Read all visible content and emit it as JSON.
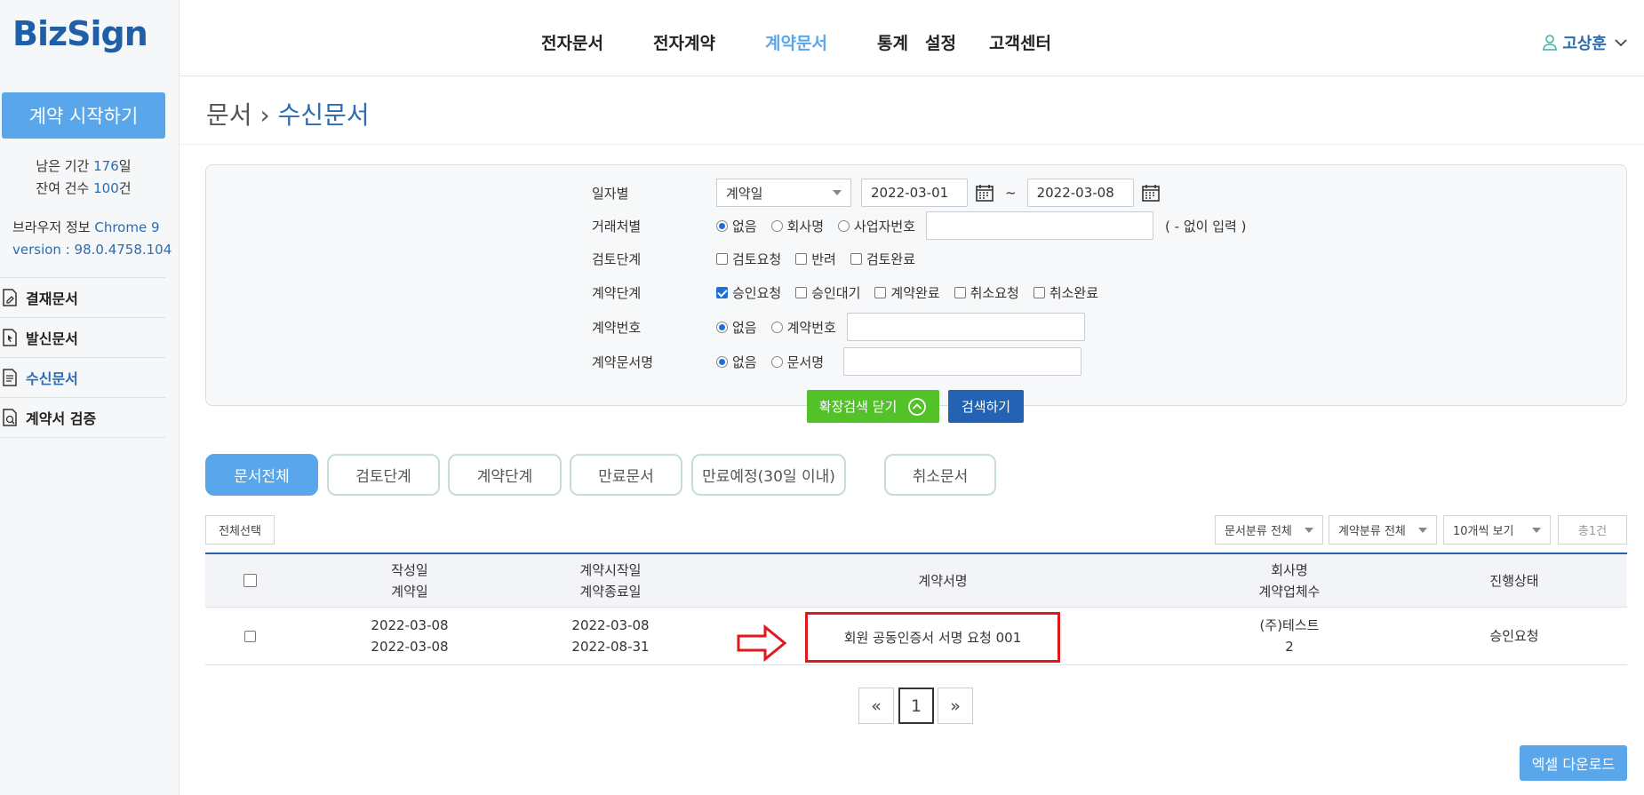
{
  "brand": {
    "logo": "BizSign"
  },
  "sidebar": {
    "start_button": "계약 시작하기",
    "remaining_period_label": "남은 기간",
    "remaining_period_value": "176",
    "remaining_period_unit": "일",
    "remaining_count_label": "잔여 건수",
    "remaining_count_value": "100",
    "remaining_count_unit": "건",
    "browser_label": "브라우저 정보",
    "browser_value": "Chrome 9",
    "version_label": "version : ",
    "version_value": "98.0.4758.104",
    "items": [
      {
        "label": "결재문서",
        "active": false
      },
      {
        "label": "발신문서",
        "active": false
      },
      {
        "label": "수신문서",
        "active": true
      },
      {
        "label": "계약서 검증",
        "active": false
      }
    ]
  },
  "topnav": {
    "items": [
      "전자문서",
      "전자계약",
      "계약문서",
      "통계",
      "설정",
      "고객센터"
    ],
    "active_index": 2,
    "user_name": "고상훈"
  },
  "breadcrumb": {
    "parent": "문서",
    "separator": "›",
    "current": "수신문서"
  },
  "search": {
    "date_label": "일자별",
    "date_type": "계약일",
    "date_from": "2022-03-01",
    "date_sep": "~",
    "date_to": "2022-03-08",
    "partner_label": "거래처별",
    "partner_options": [
      "없음",
      "회사명",
      "사업자번호"
    ],
    "partner_selected": 0,
    "partner_hint": "( - 없이 입력 )",
    "review_label": "검토단계",
    "review_options": [
      "검토요청",
      "반려",
      "검토완료"
    ],
    "contract_stage_label": "계약단계",
    "contract_stage_options": [
      "승인요청",
      "승인대기",
      "계약완료",
      "취소요청",
      "취소완료"
    ],
    "contract_stage_checked": [
      true,
      false,
      false,
      false,
      false
    ],
    "contract_no_label": "계약번호",
    "contract_no_options": [
      "없음",
      "계약번호"
    ],
    "contract_name_label": "계약문서명",
    "contract_name_options": [
      "없음",
      "문서명"
    ],
    "toggle_button": "확장검색 닫기",
    "search_button": "검색하기"
  },
  "tabs": [
    "문서전체",
    "검토단계",
    "계약단계",
    "만료문서",
    "만료예정(30일 이내)",
    "취소문서"
  ],
  "toolbar": {
    "select_all": "전체선택",
    "doc_category": "문서분류 전체",
    "contract_category": "계약분류 전체",
    "page_size": "10개씩 보기",
    "total": "총1건"
  },
  "table": {
    "headers": {
      "created_top": "작성일",
      "created_bottom": "계약일",
      "start_top": "계약시작일",
      "start_bottom": "계약종료일",
      "name": "계약서명",
      "company_top": "회사명",
      "company_bottom": "계약업체수",
      "status": "진행상태"
    },
    "rows": [
      {
        "created": "2022-03-08",
        "contract_date": "2022-03-08",
        "start": "2022-03-08",
        "end": "2022-08-31",
        "name": "회원 공동인증서 서명 요청 001",
        "company": "(주)테스트",
        "company_count": "2",
        "status": "승인요청"
      }
    ]
  },
  "pagination": {
    "prev": "«",
    "current": "1",
    "next": "»"
  },
  "excel_button": "엑셀 다운로드",
  "colors": {
    "accent": "#5aa6ea",
    "primary": "#2463b3",
    "green": "#53c228",
    "highlight": "#e0191f"
  }
}
